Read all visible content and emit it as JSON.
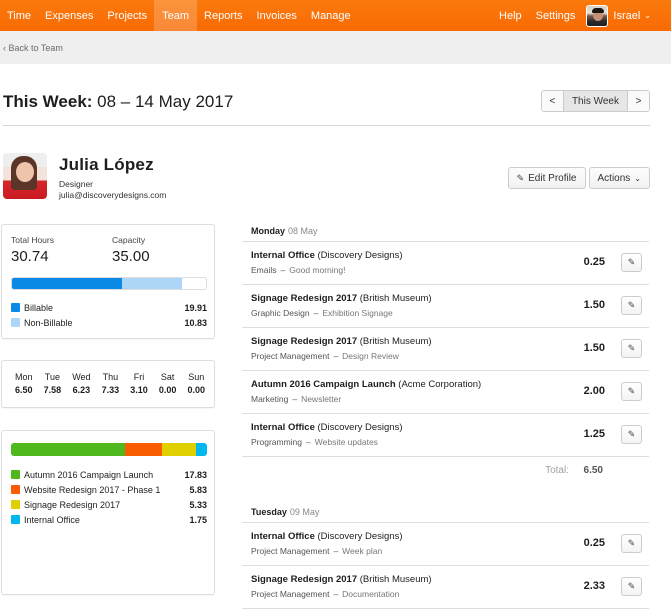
{
  "nav": {
    "items": [
      {
        "label": "Time",
        "active": false
      },
      {
        "label": "Expenses",
        "active": false
      },
      {
        "label": "Projects",
        "active": false
      },
      {
        "label": "Team",
        "active": true
      },
      {
        "label": "Reports",
        "active": false
      },
      {
        "label": "Invoices",
        "active": false
      },
      {
        "label": "Manage",
        "active": false
      }
    ],
    "help": "Help",
    "settings": "Settings",
    "user": "Israel",
    "brand_color": "#f96a05"
  },
  "breadcrumb": {
    "back_label": "Back to Team"
  },
  "week": {
    "title_bold": "This Week:",
    "title_range": "08 – 14 May 2017",
    "prev": "<",
    "current": "This Week",
    "next": ">"
  },
  "profile": {
    "name": "Julia López",
    "role": "Designer",
    "email": "julia@discoverydesigns.com",
    "edit_label": "Edit Profile",
    "actions_label": "Actions"
  },
  "summary": {
    "total_label": "Total Hours",
    "total_value": "30.74",
    "capacity_label": "Capacity",
    "capacity_value": "35.00",
    "capacity_hours": 35.0,
    "billable": {
      "label": "Billable",
      "value": "19.91",
      "hours": 19.91,
      "color": "#0a8ae6"
    },
    "nonbillable": {
      "label": "Non-Billable",
      "value": "10.83",
      "hours": 10.83,
      "color": "#add5f7"
    }
  },
  "daily": [
    {
      "day": "Mon",
      "hours": "6.50"
    },
    {
      "day": "Tue",
      "hours": "7.58"
    },
    {
      "day": "Wed",
      "hours": "6.23"
    },
    {
      "day": "Thu",
      "hours": "7.33"
    },
    {
      "day": "Fri",
      "hours": "3.10"
    },
    {
      "day": "Sat",
      "hours": "0.00"
    },
    {
      "day": "Sun",
      "hours": "0.00"
    }
  ],
  "projects": [
    {
      "name": "Autumn 2016 Campaign Launch",
      "value": "17.83",
      "hours": 17.83,
      "color": "#4fb81d"
    },
    {
      "name": "Website Redesign 2017 - Phase 1",
      "value": "5.83",
      "hours": 5.83,
      "color": "#fa5d00"
    },
    {
      "name": "Signage Redesign 2017",
      "value": "5.33",
      "hours": 5.33,
      "color": "#e0d000"
    },
    {
      "name": "Internal Office",
      "value": "1.75",
      "hours": 1.75,
      "color": "#00b7f0"
    }
  ],
  "days": [
    {
      "name": "Monday",
      "date": "08 May",
      "entries": [
        {
          "project": "Internal Office",
          "client": "(Discovery Designs)",
          "task": "Emails",
          "note": "Good morning!",
          "hours": "0.25"
        },
        {
          "project": "Signage Redesign 2017",
          "client": "(British Museum)",
          "task": "Graphic Design",
          "note": "Exhibition Signage",
          "hours": "1.50"
        },
        {
          "project": "Signage Redesign 2017",
          "client": "(British Museum)",
          "task": "Project Management",
          "note": "Design Review",
          "hours": "1.50"
        },
        {
          "project": "Autumn 2016 Campaign Launch",
          "client": "(Acme Corporation)",
          "task": "Marketing",
          "note": "Newsletter",
          "hours": "2.00"
        },
        {
          "project": "Internal Office",
          "client": "(Discovery Designs)",
          "task": "Programming",
          "note": "Website updates",
          "hours": "1.25"
        }
      ],
      "total_label": "Total:",
      "total": "6.50"
    },
    {
      "name": "Tuesday",
      "date": "09 May",
      "entries": [
        {
          "project": "Internal Office",
          "client": "(Discovery Designs)",
          "task": "Project Management",
          "note": "Week plan",
          "hours": "0.25"
        },
        {
          "project": "Signage Redesign 2017",
          "client": "(British Museum)",
          "task": "Project Management",
          "note": "Documentation",
          "hours": "2.33"
        }
      ]
    }
  ]
}
